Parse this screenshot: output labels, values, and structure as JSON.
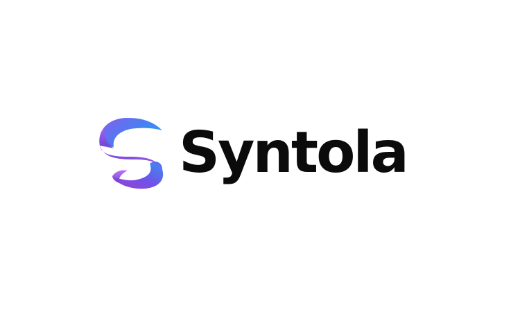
{
  "brand": {
    "name": "Syntola",
    "text_color": "#0b0b0b",
    "logo_icon": "ribbon-s-icon",
    "logo_gradient": [
      "#2f8df2",
      "#6a57e8",
      "#8f3fd6"
    ]
  },
  "background_color": "#ffffff"
}
